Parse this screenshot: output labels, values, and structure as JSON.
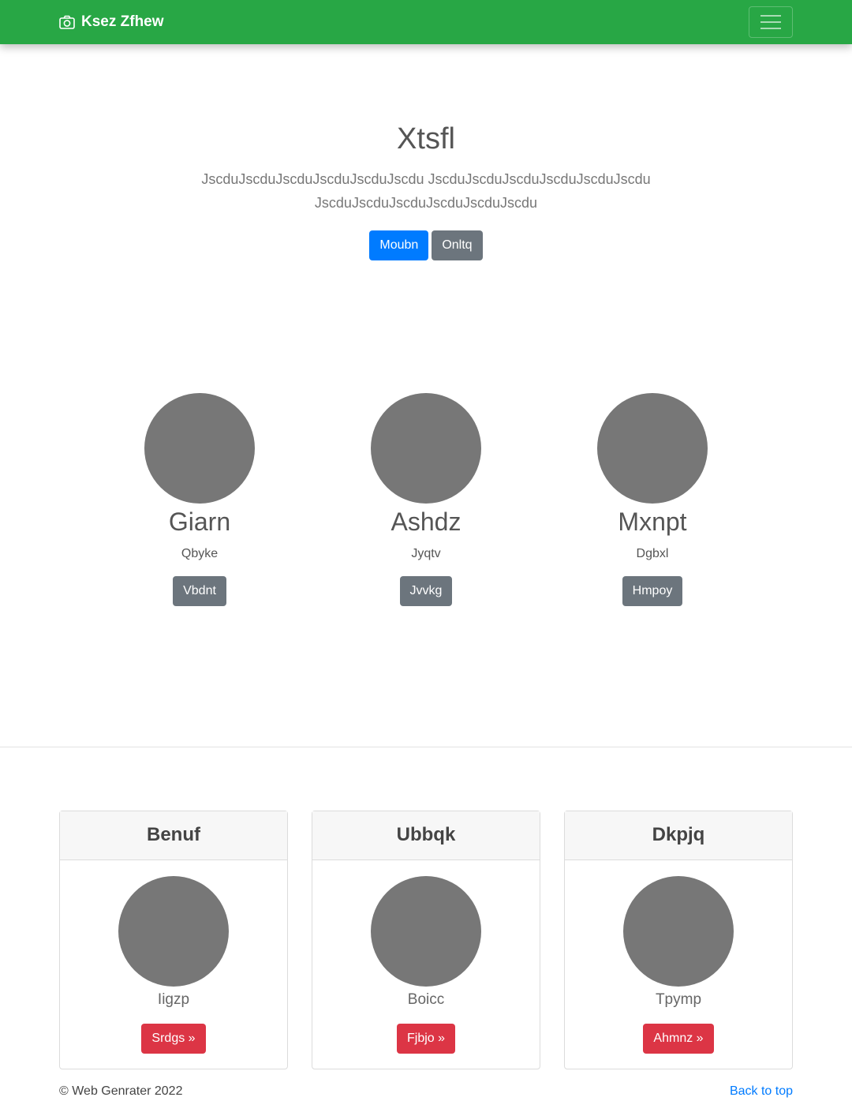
{
  "navbar": {
    "brand": "Ksez Zfhew",
    "brand_icon": "camera-icon",
    "toggler_icon": "hamburger-menu-icon",
    "background": "#28a745"
  },
  "hero": {
    "title": "Xtsfl",
    "lead": "JscduJscduJscduJscduJscduJscdu JscduJscduJscduJscduJscduJscdu JscduJscduJscduJscduJscduJscdu",
    "primary_button": "Moubn",
    "secondary_button": "Onltq"
  },
  "team": [
    {
      "name": "Giarn",
      "subtitle": "Qbyke",
      "button": "Vbdnt"
    },
    {
      "name": "Ashdz",
      "subtitle": "Jyqtv",
      "button": "Jvvkg"
    },
    {
      "name": "Mxnpt",
      "subtitle": "Dgbxl",
      "button": "Hmpoy"
    }
  ],
  "cards": [
    {
      "header": "Benuf",
      "subtitle": "Iigzp",
      "button": "Srdgs »"
    },
    {
      "header": "Ubbqk",
      "subtitle": "Boicc",
      "button": "Fjbjo »"
    },
    {
      "header": "Dkpjq",
      "subtitle": "Tpymp",
      "button": "Ahmnz »"
    }
  ],
  "footer": {
    "copyright": "© Web Genrater 2022",
    "back_to_top": "Back to top"
  },
  "colors": {
    "primary": "#007bff",
    "secondary": "#6c757d",
    "danger": "#dc3545",
    "avatar": "#777777"
  }
}
